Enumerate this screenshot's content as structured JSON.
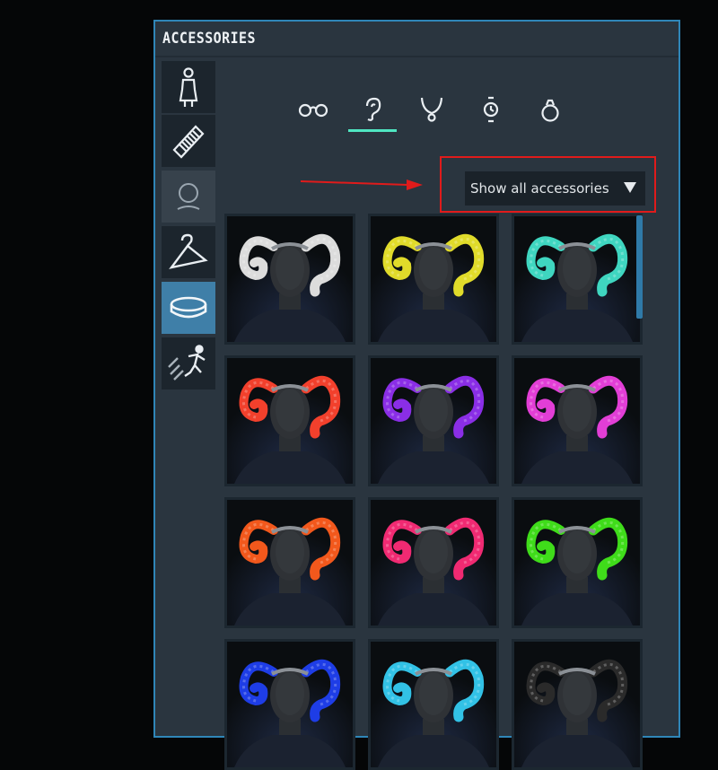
{
  "panel": {
    "title": "ACCESSORIES"
  },
  "sidebar": {
    "items": [
      {
        "icon": "body-icon",
        "state": "normal"
      },
      {
        "icon": "comb-icon",
        "state": "normal"
      },
      {
        "icon": "head-outline-icon",
        "state": "dimmed"
      },
      {
        "icon": "hanger-icon",
        "state": "normal"
      },
      {
        "icon": "ring-band-icon",
        "state": "active"
      },
      {
        "icon": "running-person-icon",
        "state": "normal"
      }
    ]
  },
  "category_tabs": [
    {
      "icon": "glasses-icon",
      "selected": false
    },
    {
      "icon": "ear-icon",
      "selected": true
    },
    {
      "icon": "necklace-icon",
      "selected": false
    },
    {
      "icon": "watch-icon",
      "selected": false
    },
    {
      "icon": "ring-icon",
      "selected": false
    }
  ],
  "filter": {
    "selected": "Show all accessories"
  },
  "annotation": {
    "box_color": "#e01b1b",
    "arrow_color": "#e01b1b"
  },
  "items": [
    {
      "horn_color": "#dcdcdc"
    },
    {
      "horn_color": "#e0db2a"
    },
    {
      "horn_color": "#3fd6c0"
    },
    {
      "horn_color": "#f2402c"
    },
    {
      "horn_color": "#8a2ee6"
    },
    {
      "horn_color": "#e23ed6"
    },
    {
      "horn_color": "#f2581c"
    },
    {
      "horn_color": "#f02a72"
    },
    {
      "horn_color": "#3fdc1a"
    },
    {
      "horn_color": "#1e3de6"
    },
    {
      "horn_color": "#32c2e6"
    },
    {
      "horn_color": "#2a2a2a"
    }
  ],
  "colors": {
    "panel_border": "#2f86b8",
    "accent_tab": "#4fe6c2",
    "active_sidebar": "#3f7fa8"
  }
}
